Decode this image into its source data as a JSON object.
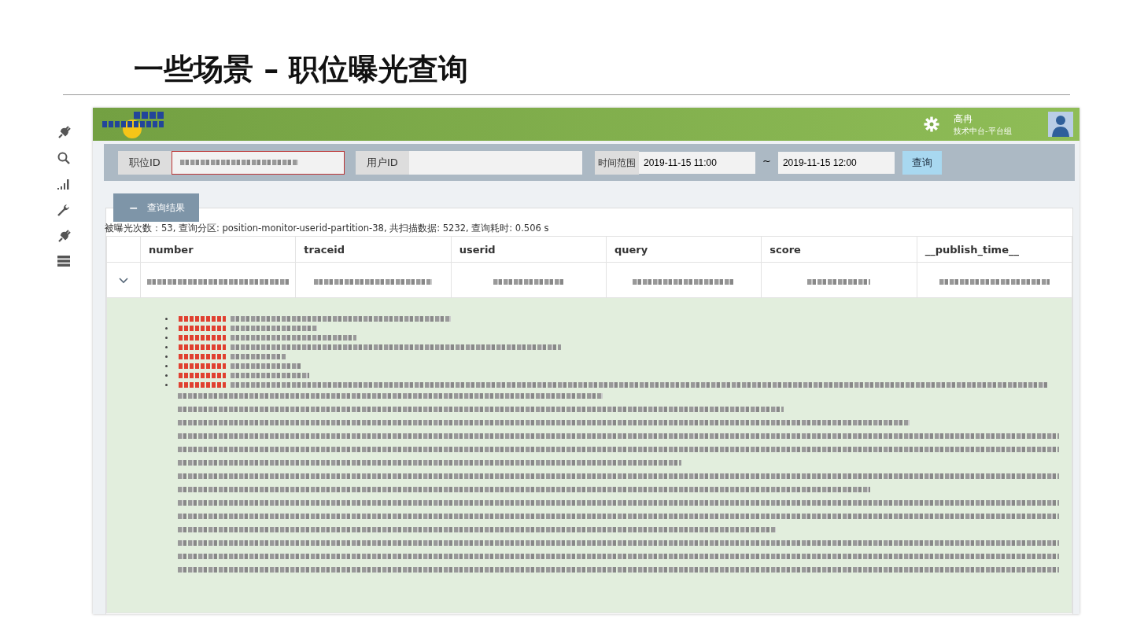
{
  "slide_title": "一些场景 – 职位曝光查询",
  "app": {
    "user": {
      "name": "高冉",
      "department": "技术中台-平台组"
    },
    "filters": {
      "position_id": {
        "label": "职位ID"
      },
      "user_id": {
        "label": "用户ID"
      },
      "time_range": {
        "label": "时间范围",
        "start": "2019-11-15 11:00",
        "separator": "~",
        "end": "2019-11-15 12:00"
      },
      "query_button": "查询"
    },
    "results": {
      "toggle_icon": "−",
      "title": "查询结果",
      "summary": "被曝光次数：53, 查询分区: position-monitor-userid-partition-38, 共扫描数据: 5232, 查询耗时: 0.506 s",
      "table": {
        "columns": [
          "number",
          "traceid",
          "userid",
          "query",
          "score",
          "__publish_time__"
        ],
        "rows": [
          {
            "expanded": true
          }
        ]
      }
    }
  }
}
